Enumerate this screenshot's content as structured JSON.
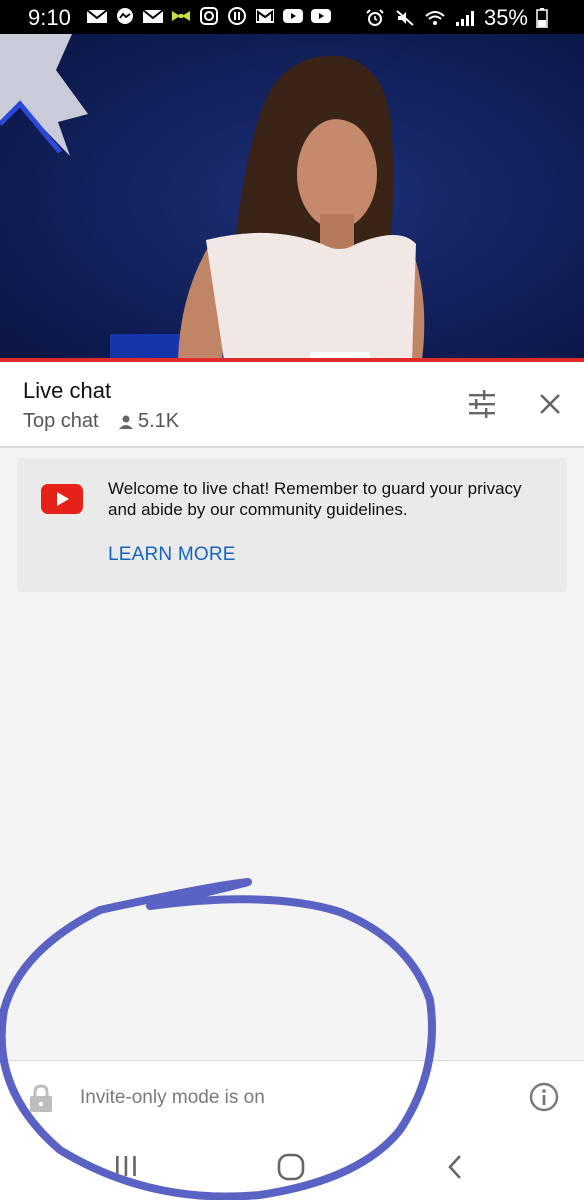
{
  "status_bar": {
    "time": "9:10",
    "battery": "35%",
    "left_icons": [
      "mail-icon",
      "messenger-icon",
      "mail-icon",
      "bowtie-icon",
      "instagram-icon",
      "news-icon",
      "gmail-icon",
      "youtube-icon",
      "youtube-icon"
    ],
    "right_icons": [
      "alarm-icon",
      "mute-icon",
      "wifi-icon",
      "signal-icon",
      "battery-icon"
    ]
  },
  "video": {
    "description_icon": "video-frame",
    "progress_color": "#e32a2a"
  },
  "chat_header": {
    "title": "Live chat",
    "mode": "Top chat",
    "viewers": "5.1K",
    "icons": [
      "tune-icon",
      "close-icon",
      "person-icon"
    ]
  },
  "welcome_card": {
    "message": "Welcome to live chat! Remember to guard your privacy and abide by our community guidelines.",
    "link": "LEARN MORE",
    "icon": "youtube-logo-icon",
    "link_color": "#1565c0"
  },
  "input_bar": {
    "status": "Invite-only mode is on",
    "icons": [
      "lock-icon",
      "info-icon"
    ]
  },
  "nav_bar": {
    "icons": [
      "recent-apps-icon",
      "home-icon",
      "back-icon"
    ]
  },
  "annotation": {
    "color": "#5a62c4"
  }
}
